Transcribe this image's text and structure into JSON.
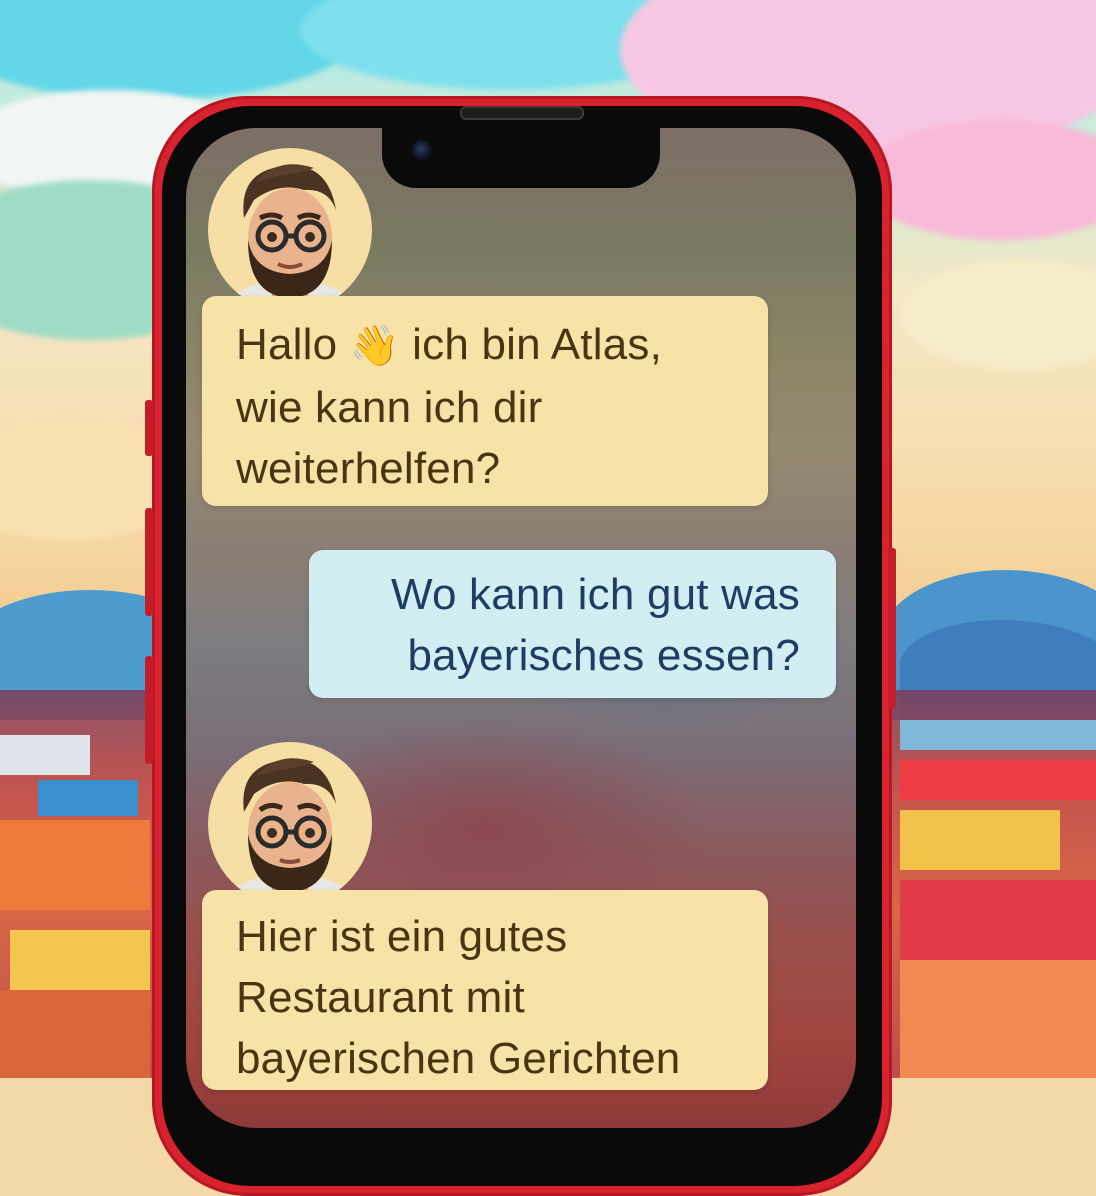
{
  "chat": {
    "messages": [
      {
        "sender": "bot",
        "lines": [
          "Hallo",
          "ich bin Atlas,",
          "wie kann ich dir",
          "weiterhelfen?"
        ],
        "emoji": "👋"
      },
      {
        "sender": "user",
        "lines": [
          "Wo kann ich gut was",
          "bayerisches essen?"
        ]
      },
      {
        "sender": "bot",
        "lines": [
          "Hier ist ein gutes",
          "Restaurant mit",
          "bayerischen Gerichten"
        ]
      }
    ]
  },
  "colors": {
    "phone_frame": "#d8222e",
    "bot_bubble": "#f7e2a8",
    "bot_text": "#4a3512",
    "user_bubble": "#d3eef2",
    "user_text": "#1f3d63"
  },
  "icons": {
    "avatar": "bearded-man-avatar-icon",
    "wave": "waving-hand-icon"
  }
}
